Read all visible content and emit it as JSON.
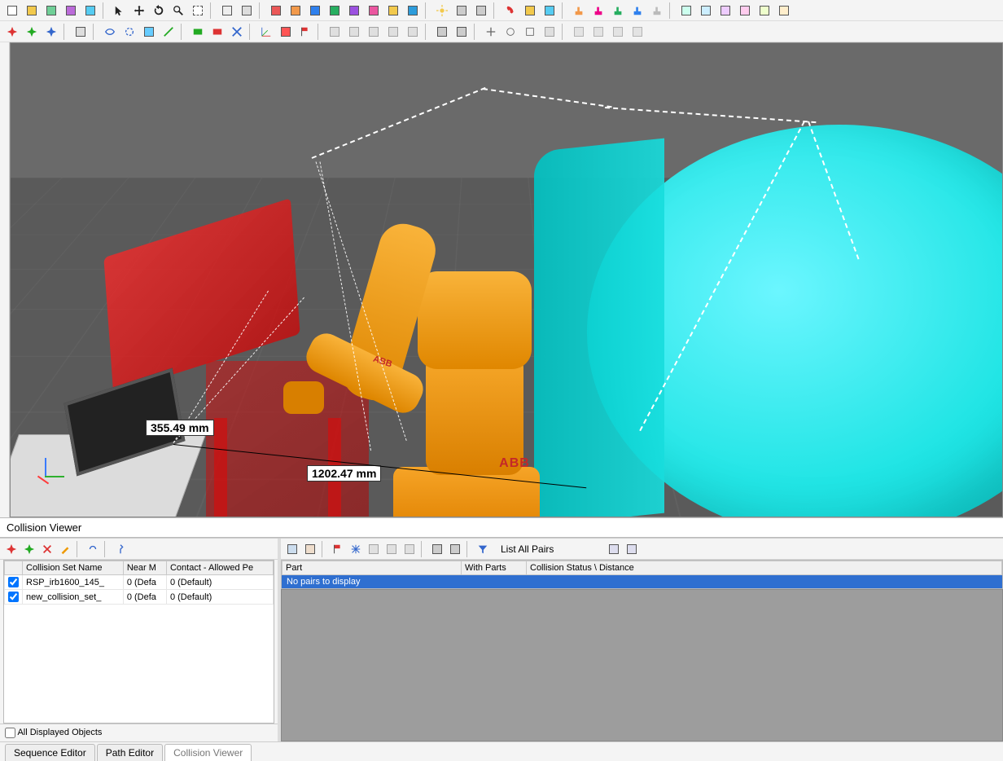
{
  "viewport": {
    "annotation1": "355.49 mm",
    "annotation2": "1202.47 mm",
    "robot_brand": "ABB"
  },
  "panel": {
    "title": "Collision Viewer"
  },
  "left_table": {
    "headers": {
      "c0": "",
      "c1": "Collision Set Name",
      "c2": "Near M",
      "c3": "Contact - Allowed Pe"
    },
    "rows": [
      {
        "checked": true,
        "name": "RSP_irb1600_145_",
        "near": "0 (Defa",
        "contact": "0 (Default)"
      },
      {
        "checked": true,
        "name": "new_collision_set_",
        "near": "0 (Defa",
        "contact": "0 (Default)"
      }
    ],
    "footer_label": "All Displayed Objects"
  },
  "right_toolbar": {
    "list_all_label": "List All Pairs"
  },
  "right_table": {
    "headers": {
      "part": "Part",
      "with": "With Parts",
      "status": "Collision Status \\ Distance"
    },
    "empty_msg": "No pairs to display"
  },
  "tabs": {
    "t1": "Sequence Editor",
    "t2": "Path Editor",
    "t3": "Collision Viewer"
  }
}
